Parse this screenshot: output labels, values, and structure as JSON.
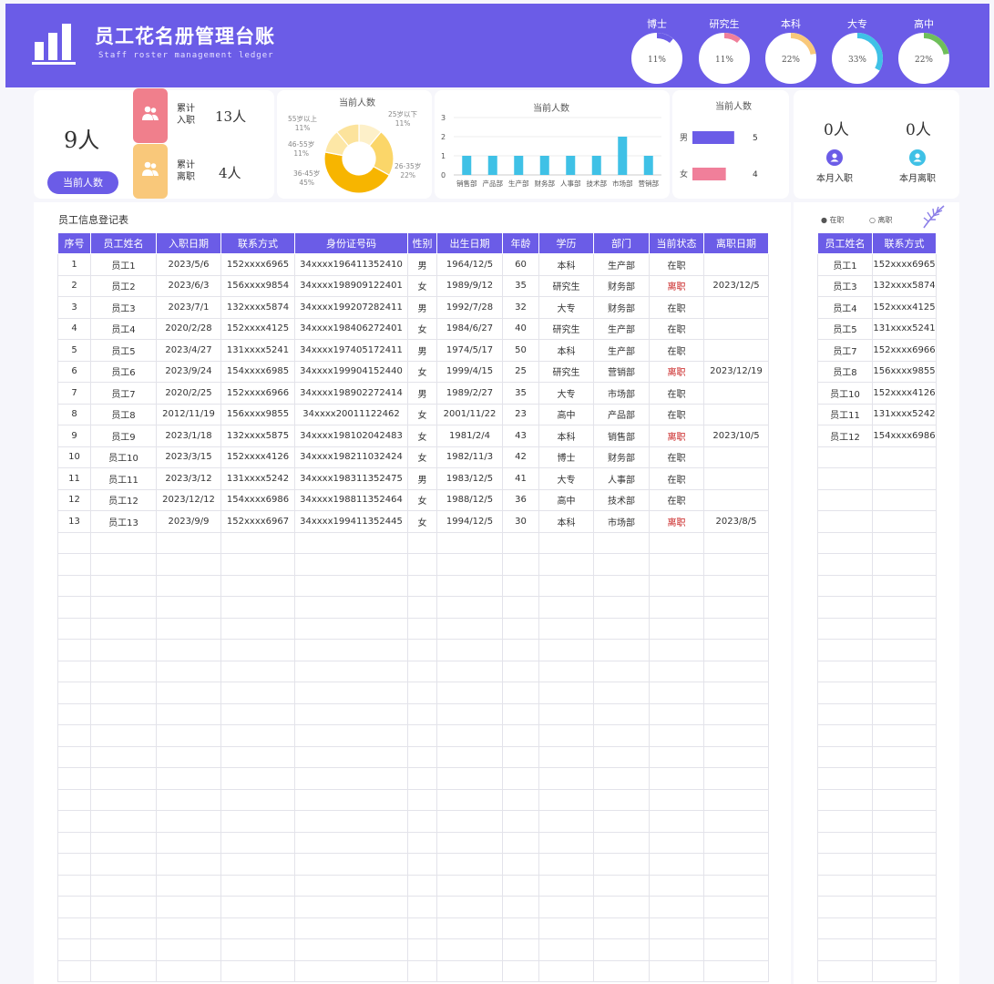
{
  "header": {
    "title": "员工花名册管理台账",
    "subtitle": "Staff roster management ledger",
    "education_rings": [
      {
        "label": "博士",
        "percent": 11,
        "text": "11%",
        "color": "#6b5ce7"
      },
      {
        "label": "研究生",
        "percent": 11,
        "text": "11%",
        "color": "#f07f9a"
      },
      {
        "label": "本科",
        "percent": 22,
        "text": "22%",
        "color": "#f9c87a"
      },
      {
        "label": "大专",
        "percent": 33,
        "text": "33%",
        "color": "#3fc1e6"
      },
      {
        "label": "高中",
        "percent": 22,
        "text": "22%",
        "color": "#6fbf5a"
      }
    ]
  },
  "summary": {
    "current_count": "9人",
    "current_label": "当前人数",
    "joined_label_1": "累计",
    "joined_label_2": "入职",
    "joined_value": "13人",
    "left_label_1": "累计",
    "left_label_2": "离职",
    "left_value": "4人",
    "month_join_value": "0人",
    "month_join_label": "本月入职",
    "month_leave_value": "0人",
    "month_leave_label": "本月离职"
  },
  "age_chart": {
    "title": "当前人数",
    "labels": [
      {
        "name": "55岁以上",
        "pct": "11%"
      },
      {
        "name": "25岁以下",
        "pct": "11%"
      },
      {
        "name": "46-55岁",
        "pct": "11%"
      },
      {
        "name": "26-35岁",
        "pct": "22%"
      },
      {
        "name": "36-45岁",
        "pct": "45%"
      }
    ]
  },
  "chart_data": [
    {
      "type": "pie",
      "title": "当前人数",
      "categories": [
        "25岁以下",
        "26-35岁",
        "36-45岁",
        "46-55岁",
        "55岁以上"
      ],
      "values": [
        11,
        22,
        45,
        11,
        11
      ]
    },
    {
      "type": "bar",
      "title": "当前人数",
      "categories": [
        "销售部",
        "产品部",
        "生产部",
        "财务部",
        "人事部",
        "技术部",
        "市场部",
        "营销部"
      ],
      "values": [
        1,
        1,
        1,
        1,
        1,
        1,
        2,
        1
      ],
      "ylim": [
        0,
        3
      ],
      "yticks": [
        "0",
        "1",
        "2",
        "3"
      ],
      "color": "#3fc1e6"
    },
    {
      "type": "bar",
      "title": "当前人数",
      "orientation": "horizontal",
      "categories": [
        "男",
        "女"
      ],
      "values": [
        5,
        4
      ],
      "colors": [
        "#6b5ce7",
        "#f07f9a"
      ]
    }
  ],
  "table_title": "员工信息登记表",
  "legend": {
    "active": "在职",
    "left": "离职"
  },
  "main_table": {
    "headers": [
      "序号",
      "员工姓名",
      "入职日期",
      "联系方式",
      "身份证号码",
      "性别",
      "出生日期",
      "年龄",
      "学历",
      "部门",
      "当前状态",
      "离职日期"
    ],
    "rows": [
      [
        "1",
        "员工1",
        "2023/5/6",
        "152xxxx6965",
        "34xxxx196411352410",
        "男",
        "1964/12/5",
        "60",
        "本科",
        "生产部",
        "在职",
        ""
      ],
      [
        "2",
        "员工2",
        "2023/6/3",
        "156xxxx9854",
        "34xxxx198909122401",
        "女",
        "1989/9/12",
        "35",
        "研究生",
        "财务部",
        "离职",
        "2023/12/5"
      ],
      [
        "3",
        "员工3",
        "2023/7/1",
        "132xxxx5874",
        "34xxxx199207282411",
        "男",
        "1992/7/28",
        "32",
        "大专",
        "财务部",
        "在职",
        ""
      ],
      [
        "4",
        "员工4",
        "2020/2/28",
        "152xxxx4125",
        "34xxxx198406272401",
        "女",
        "1984/6/27",
        "40",
        "研究生",
        "生产部",
        "在职",
        ""
      ],
      [
        "5",
        "员工5",
        "2023/4/27",
        "131xxxx5241",
        "34xxxx197405172411",
        "男",
        "1974/5/17",
        "50",
        "本科",
        "生产部",
        "在职",
        ""
      ],
      [
        "6",
        "员工6",
        "2023/9/24",
        "154xxxx6985",
        "34xxxx199904152440",
        "女",
        "1999/4/15",
        "25",
        "研究生",
        "营销部",
        "离职",
        "2023/12/19"
      ],
      [
        "7",
        "员工7",
        "2020/2/25",
        "152xxxx6966",
        "34xxxx198902272414",
        "男",
        "1989/2/27",
        "35",
        "大专",
        "市场部",
        "在职",
        ""
      ],
      [
        "8",
        "员工8",
        "2012/11/19",
        "156xxxx9855",
        "34xxxx20011122462",
        "女",
        "2001/11/22",
        "23",
        "高中",
        "产品部",
        "在职",
        ""
      ],
      [
        "9",
        "员工9",
        "2023/1/18",
        "132xxxx5875",
        "34xxxx198102042483",
        "女",
        "1981/2/4",
        "43",
        "本科",
        "销售部",
        "离职",
        "2023/10/5"
      ],
      [
        "10",
        "员工10",
        "2023/3/15",
        "152xxxx4126",
        "34xxxx198211032424",
        "女",
        "1982/11/3",
        "42",
        "博士",
        "财务部",
        "在职",
        ""
      ],
      [
        "11",
        "员工11",
        "2023/3/12",
        "131xxxx5242",
        "34xxxx198311352475",
        "男",
        "1983/12/5",
        "41",
        "大专",
        "人事部",
        "在职",
        ""
      ],
      [
        "12",
        "员工12",
        "2023/12/12",
        "154xxxx6986",
        "34xxxx198811352464",
        "女",
        "1988/12/5",
        "36",
        "高中",
        "技术部",
        "在职",
        ""
      ],
      [
        "13",
        "员工13",
        "2023/9/9",
        "152xxxx6967",
        "34xxxx199411352445",
        "女",
        "1994/12/5",
        "30",
        "本科",
        "市场部",
        "离职",
        "2023/8/5"
      ]
    ]
  },
  "side_table": {
    "headers": [
      "员工姓名",
      "联系方式"
    ],
    "rows": [
      [
        "员工1",
        "152xxxx6965"
      ],
      [
        "员工3",
        "132xxxx5874"
      ],
      [
        "员工4",
        "152xxxx4125"
      ],
      [
        "员工5",
        "131xxxx5241"
      ],
      [
        "员工7",
        "152xxxx6966"
      ],
      [
        "员工8",
        "156xxxx9855"
      ],
      [
        "员工10",
        "152xxxx4126"
      ],
      [
        "员工11",
        "131xxxx5242"
      ],
      [
        "员工12",
        "154xxxx6986"
      ]
    ]
  }
}
